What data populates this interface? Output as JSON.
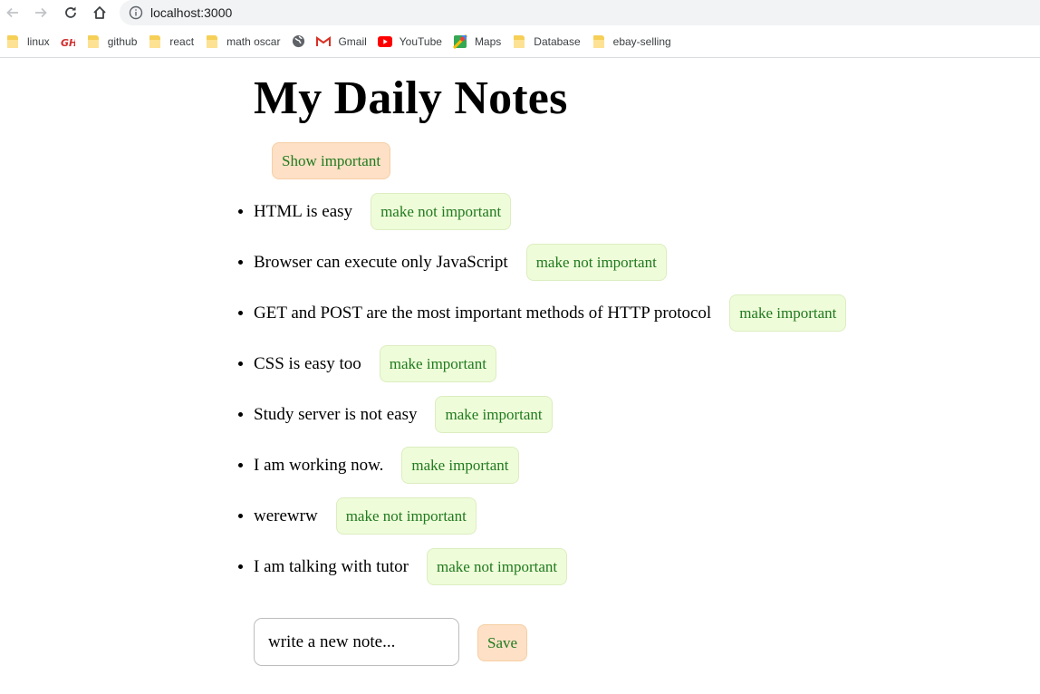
{
  "browser": {
    "url": "localhost:3000",
    "bookmarks": [
      {
        "label": "linux",
        "icon": "folder-icon"
      },
      {
        "label": "",
        "icon": "red-logo-icon"
      },
      {
        "label": "github",
        "icon": "folder-icon"
      },
      {
        "label": "react",
        "icon": "folder-icon"
      },
      {
        "label": "math oscar",
        "icon": "folder-icon"
      },
      {
        "label": "",
        "icon": "globe-icon"
      },
      {
        "label": "Gmail",
        "icon": "gmail-icon"
      },
      {
        "label": "YouTube",
        "icon": "youtube-icon"
      },
      {
        "label": "Maps",
        "icon": "maps-icon"
      },
      {
        "label": "Database",
        "icon": "folder-icon"
      },
      {
        "label": "ebay-selling",
        "icon": "folder-icon"
      }
    ]
  },
  "app": {
    "title": "My Daily Notes",
    "show_button_label": "Show important",
    "notes": [
      {
        "content": "HTML is easy",
        "button_label": "make not important"
      },
      {
        "content": "Browser can execute only JavaScript",
        "button_label": "make not important"
      },
      {
        "content": "GET and POST are the most important methods of HTTP protocol",
        "button_label": "make important"
      },
      {
        "content": "CSS is easy too",
        "button_label": "make important"
      },
      {
        "content": "Study server is not easy",
        "button_label": "make important"
      },
      {
        "content": "I am working now.",
        "button_label": "make important"
      },
      {
        "content": "werewrw",
        "button_label": "make not important"
      },
      {
        "content": "I am talking with tutor",
        "button_label": "make not important"
      }
    ],
    "new_note_placeholder": "write a new note...",
    "save_label": "Save"
  },
  "colors": {
    "button_text": "#1f7a1f",
    "orange_button_bg": "#fde0c5",
    "green_button_bg": "#effcd9"
  }
}
